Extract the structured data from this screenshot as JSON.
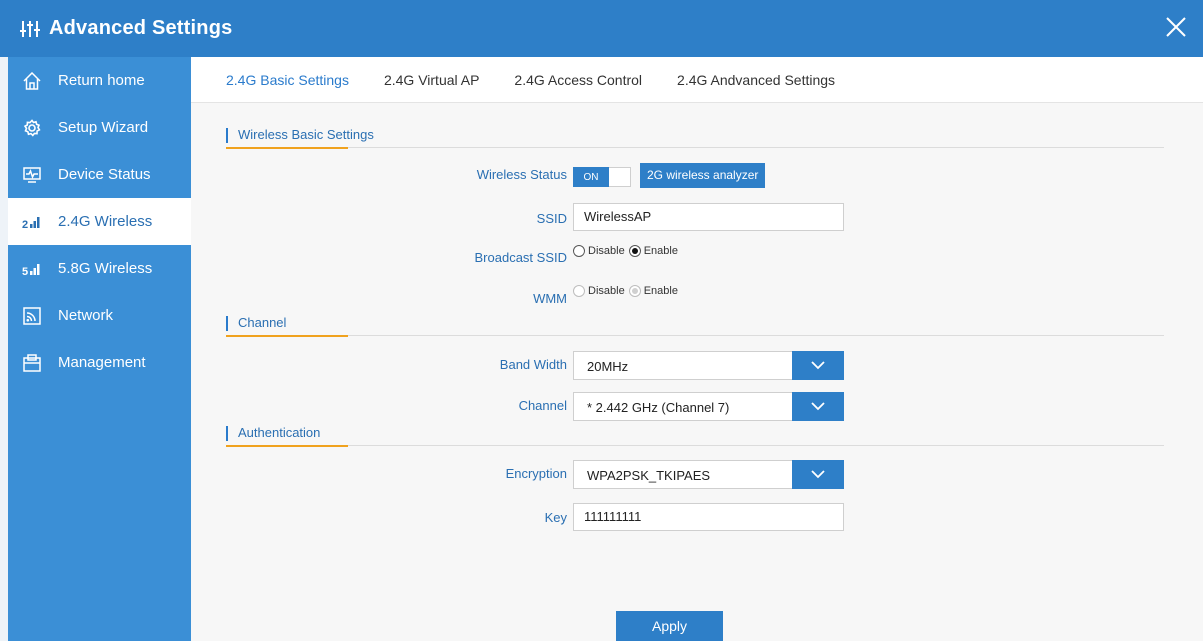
{
  "app": {
    "title": "Advanced Settings",
    "colors": {
      "primary": "#2e7fc8",
      "sidebar": "#3b8fd6",
      "accent": "#f0a21e"
    }
  },
  "sidebar": {
    "items": [
      {
        "label": "Return home",
        "icon": "home-icon",
        "active": false
      },
      {
        "label": "Setup Wizard",
        "icon": "gear-icon",
        "active": false
      },
      {
        "label": "Device Status",
        "icon": "monitor-icon",
        "active": false
      },
      {
        "label": "2.4G Wireless",
        "icon": "signal-2g-icon",
        "active": true
      },
      {
        "label": "5.8G Wireless",
        "icon": "signal-5g-icon",
        "active": false
      },
      {
        "label": "Network",
        "icon": "network-icon",
        "active": false
      },
      {
        "label": "Management",
        "icon": "clipboard-icon",
        "active": false
      }
    ]
  },
  "tabs": [
    {
      "label": "2.4G Basic Settings",
      "active": true
    },
    {
      "label": "2.4G Virtual AP",
      "active": false
    },
    {
      "label": "2.4G Access Control",
      "active": false
    },
    {
      "label": "2.4G Andvanced Settings",
      "active": false
    }
  ],
  "sections": {
    "basic": "Wireless Basic Settings",
    "channel": "Channel",
    "auth": "Authentication"
  },
  "fields": {
    "wireless_status": {
      "label": "Wireless Status",
      "toggle": "ON",
      "analyzer": "2G wireless analyzer"
    },
    "ssid": {
      "label": "SSID",
      "value": "WirelessAP"
    },
    "broadcast_ssid": {
      "label": "Broadcast SSID",
      "options": [
        "Disable",
        "Enable"
      ],
      "selected": "Enable"
    },
    "wmm": {
      "label": "WMM",
      "options": [
        "Disable",
        "Enable"
      ],
      "selected": "Enable"
    },
    "band_width": {
      "label": "Band Width",
      "value": "20MHz"
    },
    "channel": {
      "label": "Channel",
      "value": "* 2.442 GHz (Channel 7)"
    },
    "encryption": {
      "label": "Encryption",
      "value": "WPA2PSK_TKIPAES"
    },
    "key": {
      "label": "Key",
      "value": "111111111"
    }
  },
  "apply_label": "Apply"
}
